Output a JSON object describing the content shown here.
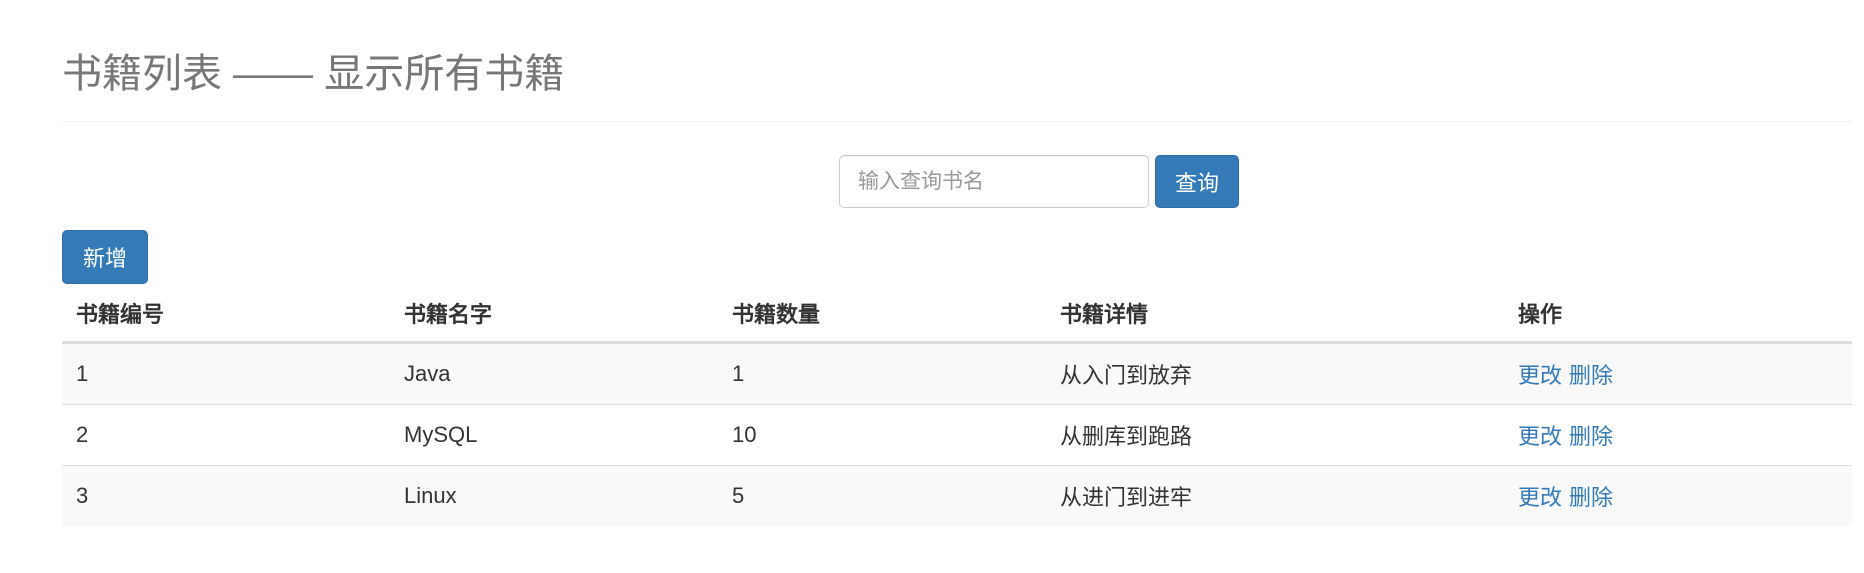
{
  "header": {
    "title": "书籍列表 —— 显示所有书籍"
  },
  "search": {
    "placeholder": "输入查询书名",
    "value": "",
    "button_label": "查询"
  },
  "toolbar": {
    "add_label": "新增"
  },
  "table": {
    "columns": [
      "书籍编号",
      "书籍名字",
      "书籍数量",
      "书籍详情",
      "操作"
    ],
    "rows": [
      {
        "id": "1",
        "name": "Java",
        "count": "1",
        "detail": "从入门到放弃",
        "edit": "更改",
        "delete": "删除"
      },
      {
        "id": "2",
        "name": "MySQL",
        "count": "10",
        "detail": "从删库到跑路",
        "edit": "更改",
        "delete": "删除"
      },
      {
        "id": "3",
        "name": "Linux",
        "count": "5",
        "detail": "从进门到进牢",
        "edit": "更改",
        "delete": "删除"
      }
    ]
  },
  "colors": {
    "primary": "#337ab7",
    "title": "#777777",
    "stripe": "#f9f9f9"
  }
}
